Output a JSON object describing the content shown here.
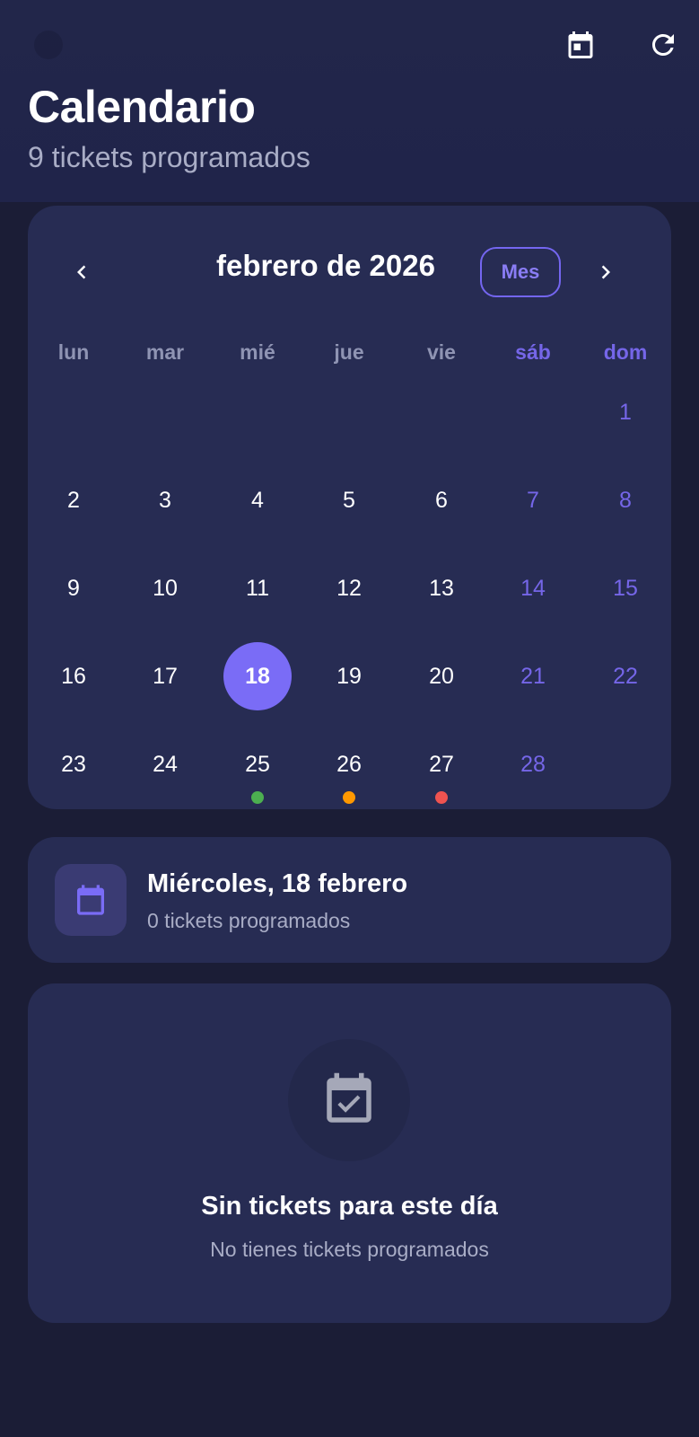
{
  "header": {
    "title": "Calendario",
    "subtitle": "9 tickets programados",
    "icons": [
      "calendar-icon",
      "refresh-icon"
    ]
  },
  "calendar": {
    "month_title": "febrero de 2026",
    "view_button": "Mes",
    "weekdays": [
      "lun",
      "mar",
      "mié",
      "jue",
      "vie",
      "sáb",
      "dom"
    ],
    "weeks": [
      [
        "",
        "",
        "",
        "",
        "",
        "",
        "1"
      ],
      [
        "2",
        "3",
        "4",
        "5",
        "6",
        "7",
        "8"
      ],
      [
        "9",
        "10",
        "11",
        "12",
        "13",
        "14",
        "15"
      ],
      [
        "16",
        "17",
        "18",
        "19",
        "20",
        "21",
        "22"
      ],
      [
        "23",
        "24",
        "25",
        "26",
        "27",
        "28",
        ""
      ]
    ],
    "selected_day": "18",
    "event_dots": [
      {
        "day": "25",
        "color": "#4caf50"
      },
      {
        "day": "26",
        "color": "#ff9800"
      },
      {
        "day": "27",
        "color": "#ef5350"
      }
    ],
    "colors": {
      "accent": "#7a6cf6",
      "weekend": "#7566e8"
    }
  },
  "selected_day_card": {
    "title": "Miércoles, 18 febrero",
    "subtitle": "0 tickets programados"
  },
  "empty_state": {
    "title": "Sin tickets para este día",
    "subtitle": "No tienes tickets programados"
  }
}
